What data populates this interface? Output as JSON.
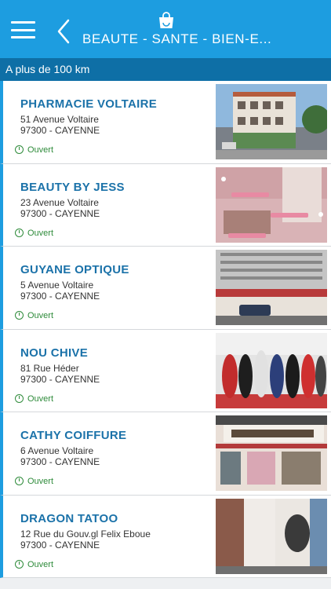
{
  "header": {
    "title": "BEAUTE - SANTE - BIEN-E...",
    "menu_icon": "hamburger-menu-icon",
    "back_icon": "chevron-left-icon",
    "category_icon": "shopping-bag-icon",
    "color": "#1d9de0"
  },
  "filter": {
    "distance_label": "A plus de 100 km",
    "color": "#0e6fa6"
  },
  "listings": [
    {
      "name": "PHARMACIE VOLTAIRE",
      "address": "51 Avenue Voltaire",
      "city": "97300 - CAYENNE",
      "status": "Ouvert"
    },
    {
      "name": "BEAUTY BY JESS",
      "address": "23 Avenue Voltaire",
      "city": "97300 - CAYENNE",
      "status": "Ouvert"
    },
    {
      "name": "GUYANE OPTIQUE",
      "address": "5 Avenue Voltaire",
      "city": "97300 - CAYENNE",
      "status": "Ouvert"
    },
    {
      "name": "NOU CHIVE",
      "address": "81 Rue Héder",
      "city": "97300 - CAYENNE",
      "status": "Ouvert"
    },
    {
      "name": "CATHY COIFFURE",
      "address": "6 Avenue Voltaire",
      "city": "97300 - CAYENNE",
      "status": "Ouvert"
    },
    {
      "name": "DRAGON TATOO",
      "address": "12 Rue du Gouv.gl Felix Eboue",
      "city": "97300 - CAYENNE",
      "status": "Ouvert"
    }
  ],
  "colors": {
    "name_text": "#1b72a9",
    "open_status": "#2e8b3a"
  }
}
